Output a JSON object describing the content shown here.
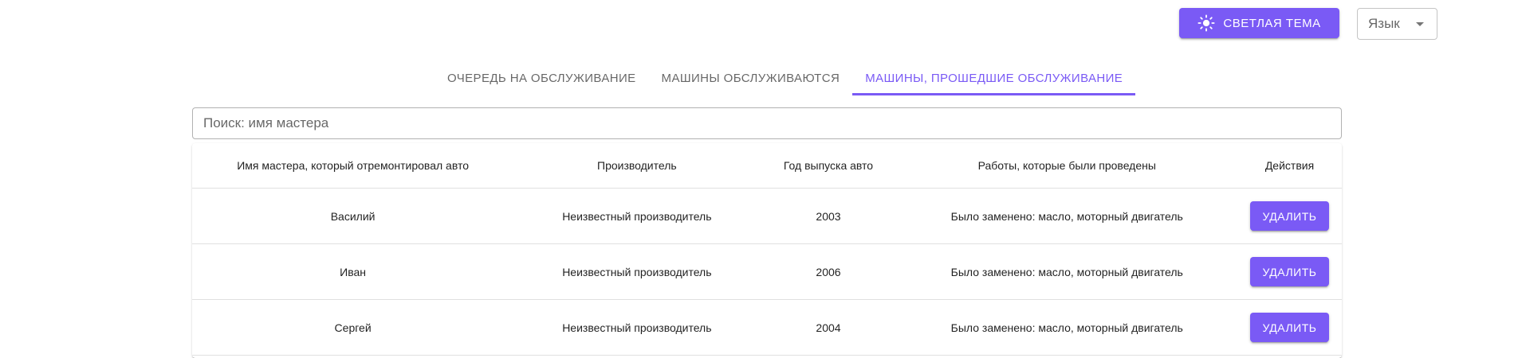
{
  "header": {
    "theme_button_label": "Светлая тема",
    "theme_icon": "sun-icon",
    "language_select_value": "Язык"
  },
  "tabs": [
    {
      "label": "Очередь на обслуживание",
      "active": false
    },
    {
      "label": "Машины обслуживаются",
      "active": false
    },
    {
      "label": "Машины, прошедшие обслуживание",
      "active": true
    }
  ],
  "search": {
    "placeholder": "Поиск: имя мастера",
    "value": ""
  },
  "table": {
    "columns": [
      "Имя мастера, который отремонтировал авто",
      "Производитель",
      "Год выпуска авто",
      "Работы, которые были проведены",
      "Действия"
    ],
    "rows": [
      {
        "master": "Василий",
        "maker": "Неизвестный производитель",
        "year": "2003",
        "works": "Было заменено: масло, моторный двигатель",
        "action": "Удалить"
      },
      {
        "master": "Иван",
        "maker": "Неизвестный производитель",
        "year": "2006",
        "works": "Было заменено: масло, моторный двигатель",
        "action": "Удалить"
      },
      {
        "master": "Сергей",
        "maker": "Неизвестный производитель",
        "year": "2004",
        "works": "Было заменено: масло, моторный двигатель",
        "action": "Удалить"
      }
    ]
  },
  "colors": {
    "accent": "#7a5af5"
  }
}
